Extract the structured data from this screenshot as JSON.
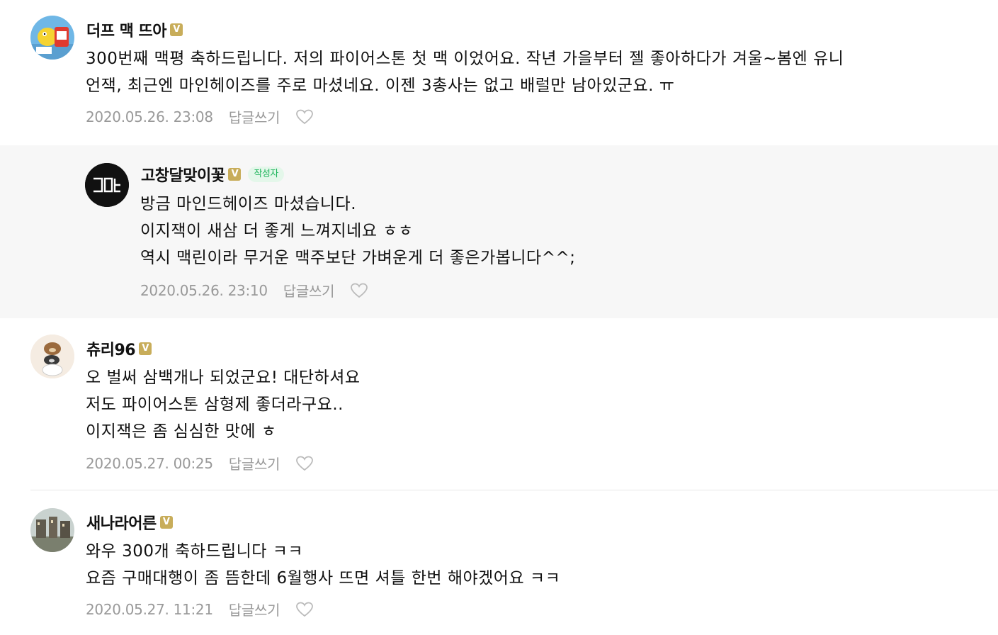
{
  "comments": [
    {
      "nickname": "더프 맥 뜨아",
      "verified_badge": "V",
      "text": "300번째 맥평 축하드립니다. 저의 파이어스톤 첫 맥 이었어요. 작년 가을부터 젤 좋아하다가 겨울~봄엔 유니\n언잭, 최근엔 마인헤이즈를 주로 마셨네요. 이젠 3총사는 없고 배럴만 남아있군요. ㅠ",
      "date": "2020.05.26. 23:08",
      "reply_label": "답글쓰기",
      "like_icon": "heart-outline-icon"
    },
    {
      "nickname": "고창달맞이꽃",
      "verified_badge": "V",
      "author_tag": "작성자",
      "avatar_text": "고답",
      "text": "방금 마인드헤이즈 마셨습니다.\n이지잭이 새삼 더 좋게 느껴지네요 ㅎㅎ\n역시 맥린이라 무거운 맥주보단 가벼운게 더 좋은가봅니다^^;",
      "date": "2020.05.26. 23:10",
      "reply_label": "답글쓰기",
      "like_icon": "heart-outline-icon"
    },
    {
      "nickname": "츄리96",
      "verified_badge": "V",
      "text": "오 벌써 삼백개나 되었군요! 대단하셔요\n저도 파이어스톤 삼형제 좋더라구요..\n이지잭은 좀 심심한 맛에 ㅎ",
      "date": "2020.05.27. 00:25",
      "reply_label": "답글쓰기",
      "like_icon": "heart-outline-icon"
    },
    {
      "nickname": "새나라어른",
      "verified_badge": "V",
      "text": "와우 300개 축하드립니다 ㅋㅋ\n요즘 구매대행이 좀 뜸한데 6월행사 뜨면 셔틀 한번 해야겠어요 ㅋㅋ",
      "date": "2020.05.27. 11:21",
      "reply_label": "답글쓰기",
      "like_icon": "heart-outline-icon"
    }
  ],
  "colors": {
    "badge": "#c8ad5a",
    "author_tag_text": "#20b55d",
    "author_tag_bg": "#e4f7ea",
    "reply_bg": "#f7f7f7",
    "meta_text": "#999999"
  }
}
